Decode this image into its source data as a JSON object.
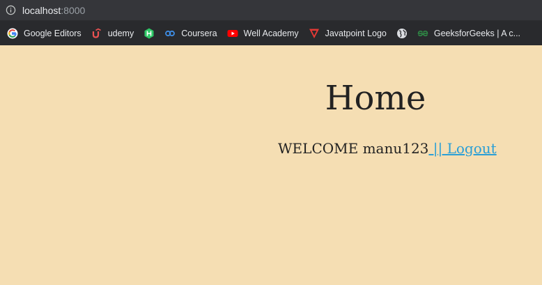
{
  "browser": {
    "url_host": "localhost",
    "url_port": ":8000"
  },
  "bookmarks": [
    {
      "label": "Google Editors",
      "icon": "google-icon"
    },
    {
      "label": "udemy",
      "icon": "udemy-icon"
    },
    {
      "label": "",
      "icon": "hackerrank-icon"
    },
    {
      "label": "Coursera",
      "icon": "coursera-icon"
    },
    {
      "label": "Well Academy",
      "icon": "youtube-icon"
    },
    {
      "label": "Javatpoint Logo",
      "icon": "javatpoint-icon"
    },
    {
      "label": "",
      "icon": "globe-icon"
    },
    {
      "label": "GeeksforGeeks | A c...",
      "icon": "geeksforgeeks-icon"
    }
  ],
  "page": {
    "title": "Home",
    "welcome_text": "WELCOME manu123",
    "logout_link": " || Logout"
  },
  "colors": {
    "page_background": "#f5deb3",
    "link": "#2a9fd6",
    "toolbar": "#35363a",
    "bookmarks_bar": "#292a2d"
  }
}
